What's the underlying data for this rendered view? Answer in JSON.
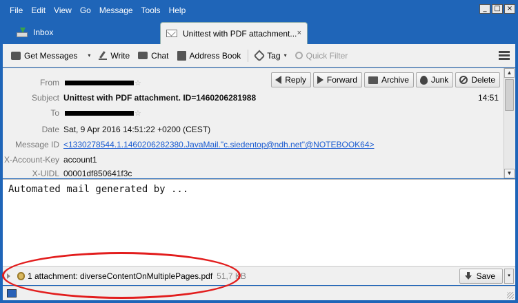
{
  "menubar": {
    "items": [
      "File",
      "Edit",
      "View",
      "Go",
      "Message",
      "Tools",
      "Help"
    ],
    "window_controls": [
      "_",
      "□",
      "×"
    ]
  },
  "tabs": {
    "inbox_label": "Inbox",
    "active_label": "Unittest with PDF attachment...",
    "close_glyph": "×"
  },
  "toolbar": {
    "get_messages": "Get Messages",
    "write": "Write",
    "chat": "Chat",
    "address_book": "Address Book",
    "tag": "Tag",
    "quick_filter": "Quick Filter",
    "drop_glyph": "▾"
  },
  "header": {
    "buttons": {
      "reply": "Reply",
      "forward": "Forward",
      "archive": "Archive",
      "junk": "Junk",
      "delete": "Delete"
    },
    "labels": {
      "from": "From",
      "subject": "Subject",
      "to": "To",
      "date": "Date",
      "message_id": "Message ID",
      "x_account_key": "X-Account-Key",
      "x_uidl": "X-UIDL"
    },
    "values": {
      "subject": "Unittest with PDF attachment. ID=1460206281988",
      "time": "14:51",
      "date": "Sat, 9 Apr 2016 14:51:22 +0200 (CEST)",
      "message_id": "<1330278544.1.1460206282380.JavaMail.\"c.siedentop@ndh.net\"@NOTEBOOK64>",
      "x_account_key": "account1",
      "x_uidl": "00001df850641f3c"
    },
    "star_glyph": "☆"
  },
  "scroll": {
    "up_glyph": "▲",
    "down_glyph": "▼"
  },
  "body": {
    "text": "Automated mail generated by ..."
  },
  "attachment": {
    "label": "1 attachment: diverseContentOnMultiplePages.pdf",
    "size": "51,7 KB",
    "save_label": "Save",
    "drop_glyph": "▾"
  },
  "colors": {
    "titlebar": "#1f65b8",
    "annotation": "#e21d1d",
    "link": "#1a5bd1"
  }
}
